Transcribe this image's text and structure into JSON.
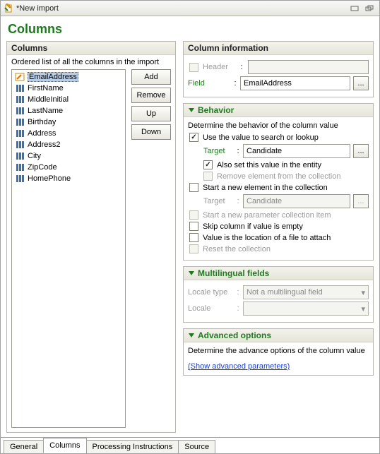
{
  "window": {
    "title": "*New import"
  },
  "page_title": "Columns",
  "columns_panel": {
    "title": "Columns",
    "subtitle": "Ordered list of all the columns in the import",
    "items": [
      {
        "label": "EmailAddress",
        "selected": true,
        "kind": "edit"
      },
      {
        "label": "FirstName",
        "selected": false,
        "kind": "col"
      },
      {
        "label": "MiddleInitial",
        "selected": false,
        "kind": "col"
      },
      {
        "label": "LastName",
        "selected": false,
        "kind": "col"
      },
      {
        "label": "Birthday",
        "selected": false,
        "kind": "col"
      },
      {
        "label": "Address",
        "selected": false,
        "kind": "col"
      },
      {
        "label": "Address2",
        "selected": false,
        "kind": "col"
      },
      {
        "label": "City",
        "selected": false,
        "kind": "col"
      },
      {
        "label": "ZipCode",
        "selected": false,
        "kind": "col"
      },
      {
        "label": "HomePhone",
        "selected": false,
        "kind": "col"
      }
    ],
    "buttons": {
      "add": "Add",
      "remove": "Remove",
      "up": "Up",
      "down": "Down"
    }
  },
  "column_info": {
    "title": "Column information",
    "header_label": "Header",
    "header_value": "",
    "field_label": "Field",
    "field_value": "EmailAddress"
  },
  "behavior": {
    "title": "Behavior",
    "note": "Determine the behavior of the column value",
    "use_search": {
      "label": "Use the value to search or lookup",
      "checked": true
    },
    "target1_label": "Target",
    "target1_value": "Candidate",
    "also_set": {
      "label": "Also set this value in the entity",
      "checked": true
    },
    "remove_elem": {
      "label": "Remove element from the collection",
      "checked": false,
      "disabled": true
    },
    "start_new": {
      "label": "Start a new element in the collection",
      "checked": false
    },
    "target2_label": "Target",
    "target2_value": "Candidate",
    "start_param": {
      "label": "Start a new parameter collection item",
      "checked": false,
      "disabled": true
    },
    "skip_empty": {
      "label": "Skip column if value is empty",
      "checked": false
    },
    "file_loc": {
      "label": "Value is the location of a file to attach",
      "checked": false
    },
    "reset": {
      "label": "Reset the collection",
      "checked": false,
      "disabled": true
    }
  },
  "multilingual": {
    "title": "Multilingual fields",
    "locale_type_label": "Locale type",
    "locale_type_value": "Not a multilingual field",
    "locale_label": "Locale",
    "locale_value": ""
  },
  "advanced": {
    "title": "Advanced options",
    "note": "Determine the advance options of the column value",
    "link": "(Show advanced parameters)"
  },
  "tabs": [
    "General",
    "Columns",
    "Processing Instructions",
    "Source"
  ],
  "active_tab": 1
}
